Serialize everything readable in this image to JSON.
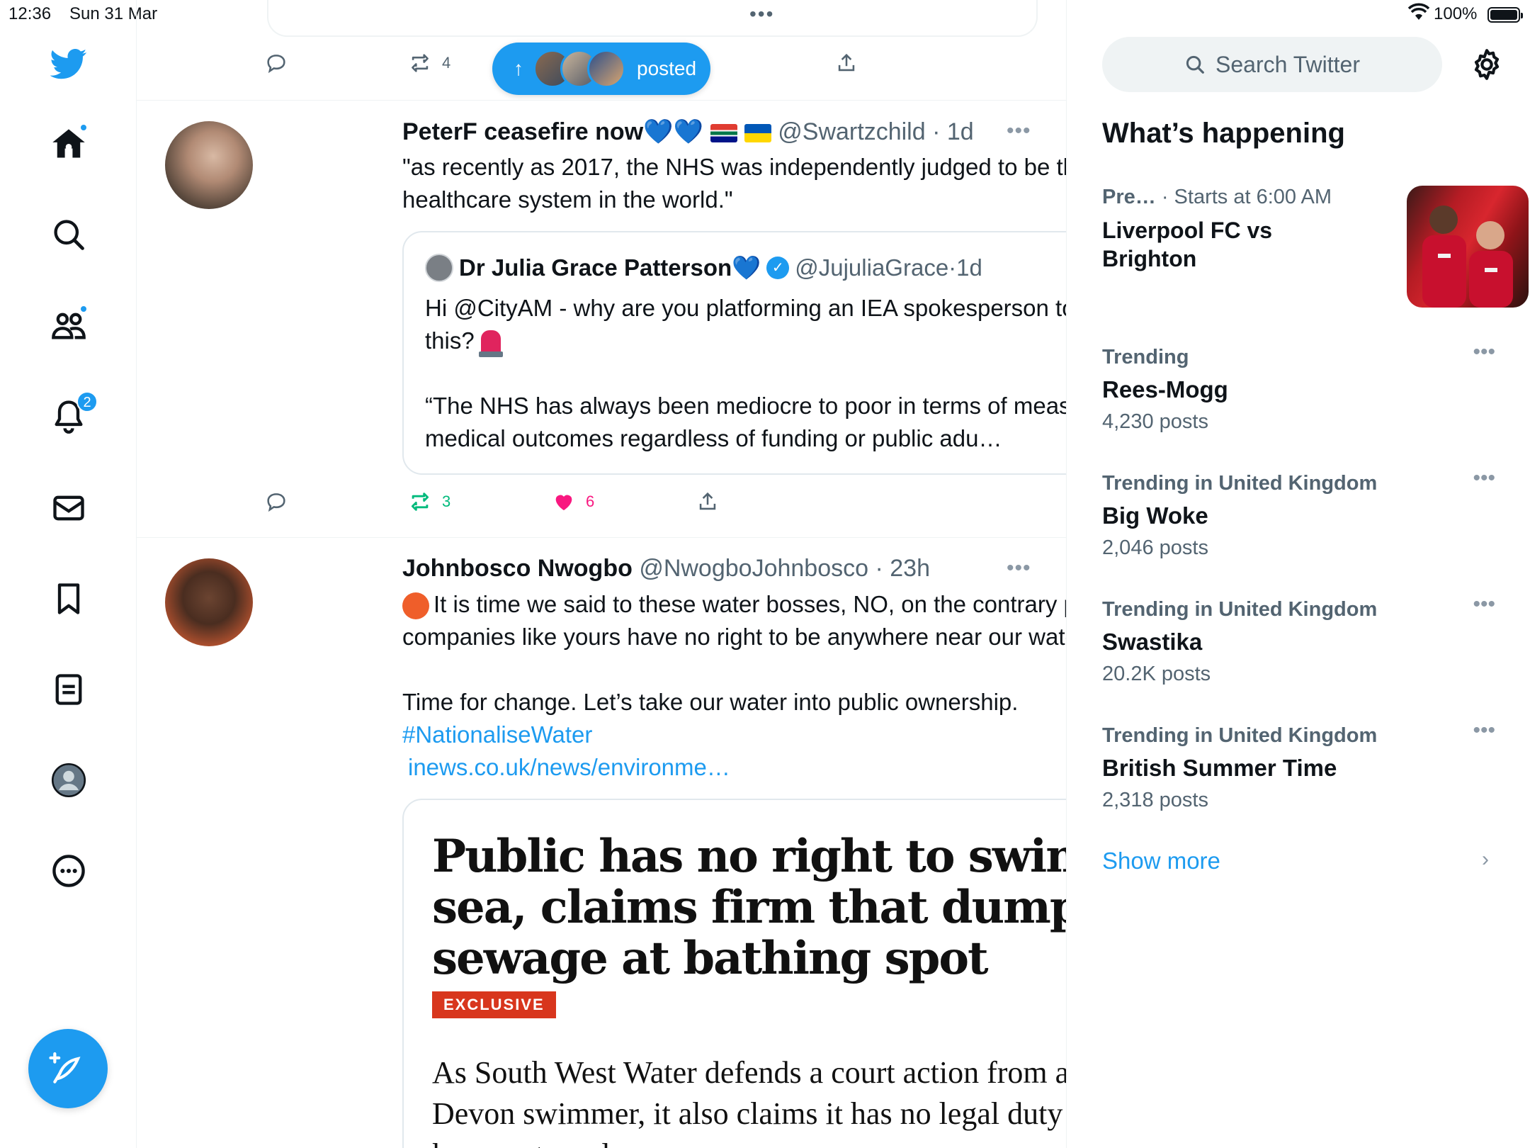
{
  "status_bar": {
    "time": "12:36",
    "date": "Sun 31 Mar",
    "multitask_dots": "•••",
    "battery": "100%"
  },
  "nav": {
    "items": [
      "twitter-logo",
      "home",
      "explore",
      "communities",
      "notifications",
      "messages",
      "bookmarks",
      "lists",
      "profile",
      "more"
    ],
    "notifications_badge": "2"
  },
  "timeline": {
    "prev_tweet_actions": {
      "retweets": "4"
    },
    "new_posts_pill": {
      "arrow": "↑",
      "label": "posted"
    },
    "tweets": [
      {
        "name": "PeterF ceasefire now",
        "name_emoji": "💙💙",
        "handle": "@Swartzchild",
        "time": "1d",
        "more": "•••",
        "text": "\"as recently as 2017, the NHS was independently judged to be the best healthcare system in the world.\"",
        "quote": {
          "name": "Dr Julia Grace Patterson",
          "name_emoji": "💙",
          "handle": "@JujuliaGrace",
          "time": "1d",
          "text_line1": "Hi @CityAM - why are you platforming an IEA spokesperson to say this?",
          "text_line2": "“The NHS has always been mediocre to poor in terms of measurable medical outcomes regardless of funding or public adu…"
        },
        "retweets": "3",
        "likes": "6"
      },
      {
        "name": "Johnbosco Nwogbo",
        "handle": "@NwogboJohnbosco",
        "time": "23h",
        "more": "•••",
        "text_line1": "It is time we said to these water bosses, NO, on the contrary private companies like yours have no right to be anywhere near our water.",
        "text_line2": "Time for change. Let’s take our water into public ownership.",
        "hashtag": "#NationaliseWater",
        "link": "inews.co.uk/news/environme…",
        "article": {
          "headline": "Public has no right to swim in sea, claims firm that dumped sewage at bathing spot",
          "tag": "EXCLUSIVE",
          "subhead": "As South West Water defends a court action from a Devon swimmer, it also claims it has no legal duty to keep waters clean"
        }
      }
    ]
  },
  "sidebar": {
    "search_placeholder": "Search Twitter",
    "section_title": "What’s happening",
    "event": {
      "category": "Pre…",
      "starts": "· Starts at 6:00 AM",
      "title": "Liverpool FC vs Brighton"
    },
    "trends": [
      {
        "context": "Trending",
        "name": "Rees-Mogg",
        "count": "4,230 posts"
      },
      {
        "context": "Trending in United Kingdom",
        "name": "Big Woke",
        "count": "2,046 posts"
      },
      {
        "context": "Trending in United Kingdom",
        "name": "Swastika",
        "count": "20.2K posts"
      },
      {
        "context": "Trending in United Kingdom",
        "name": "British Summer Time",
        "count": "2,318 posts"
      }
    ],
    "trend_more": "•••",
    "show_more": "Show more",
    "chevron": "›"
  },
  "colors": {
    "accent": "#1d9bf0",
    "like": "#f91880",
    "retweet": "#00ba7c",
    "muted": "#536471"
  }
}
